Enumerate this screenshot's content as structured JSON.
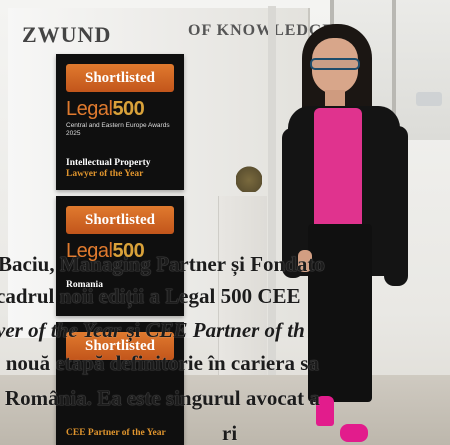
{
  "wall_sign": {
    "left": "ZWUND",
    "right": "OF KNOWLEDGE"
  },
  "awards": [
    {
      "badge": "Shortlisted",
      "logo_prefix": "Legal",
      "logo_number": "500",
      "subtitle": "Central and Eastern Europe Awards 2025",
      "category_line1": "Intellectual Property",
      "category_line2": "Lawyer of the Year"
    },
    {
      "badge": "Shortlisted",
      "logo_prefix": "Legal",
      "logo_number": "500",
      "subtitle": "",
      "category_line1": "Romania",
      "category_line2": ""
    },
    {
      "badge": "Shortlisted",
      "logo_prefix": "",
      "logo_number": "",
      "subtitle": "",
      "category_line1": "",
      "category_line2": "CEE Partner of the Year"
    }
  ],
  "caption": {
    "line1": "Baciu, Managing Partner și Fondato",
    "line2": "cadrul noii ediții a Legal 500 CEE",
    "line3_italic_a": "wyer of the Year",
    "line3_plain": " și ",
    "line3_italic_b": "CEE Partner of th",
    "line4": "o nouă etapă definitorie în cariera sa",
    "line5": "n România. Ea este singurul avocat a",
    "line6": "ri"
  },
  "colors": {
    "accent_orange": "#e07a2e",
    "top_magenta": "#e0338e",
    "shoe_pink": "#e21c8c",
    "jacket_black": "#141414"
  }
}
